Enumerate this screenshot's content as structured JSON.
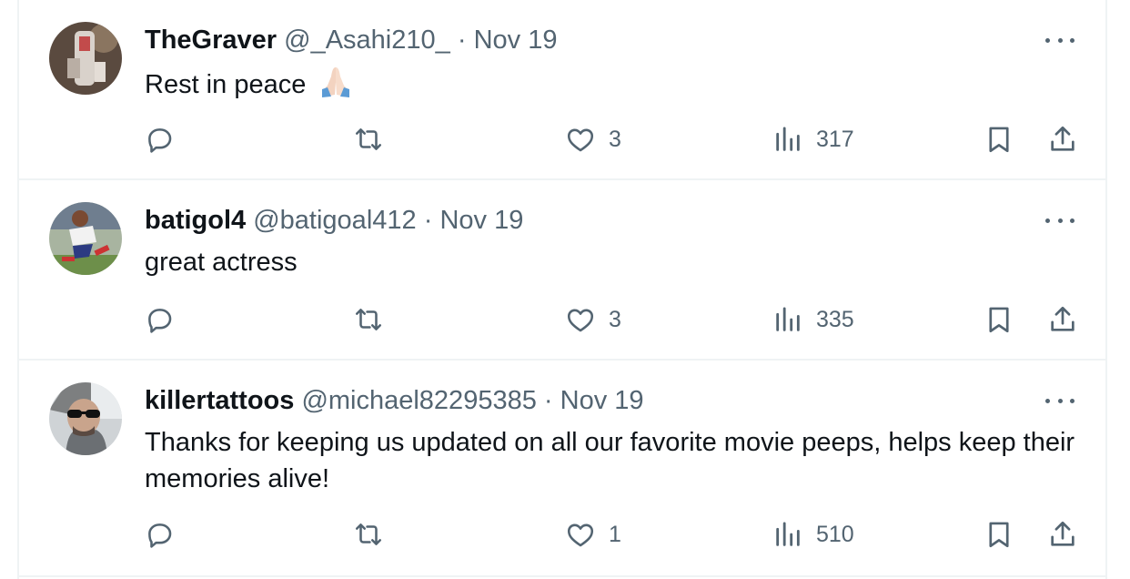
{
  "colors": {
    "text_primary": "#0f1419",
    "text_secondary": "#536471",
    "divider": "#eff3f4"
  },
  "icons": {
    "reply": "speech-bubble-icon",
    "retweet": "repost-arrows-icon",
    "like": "heart-icon",
    "views": "bar-chart-icon",
    "bookmark": "bookmark-icon",
    "share": "share-upload-icon",
    "more": "ellipsis-icon"
  },
  "tweets": [
    {
      "name": "TheGraver",
      "handle": "@_Asahi210_",
      "separator": "·",
      "date": "Nov 19",
      "text": "Rest in peace",
      "emoji": "folded-hands",
      "likes": "3",
      "views": "317"
    },
    {
      "name": "batigol4",
      "handle": "@batigoal412",
      "separator": "·",
      "date": "Nov 19",
      "text": "great actress",
      "likes": "3",
      "views": "335"
    },
    {
      "name": "killertattoos",
      "handle": "@michael82295385",
      "separator": "·",
      "date": "Nov 19",
      "text": "Thanks for keeping us updated on all our favorite movie peeps, helps keep their memories alive!",
      "likes": "1",
      "views": "510"
    }
  ]
}
